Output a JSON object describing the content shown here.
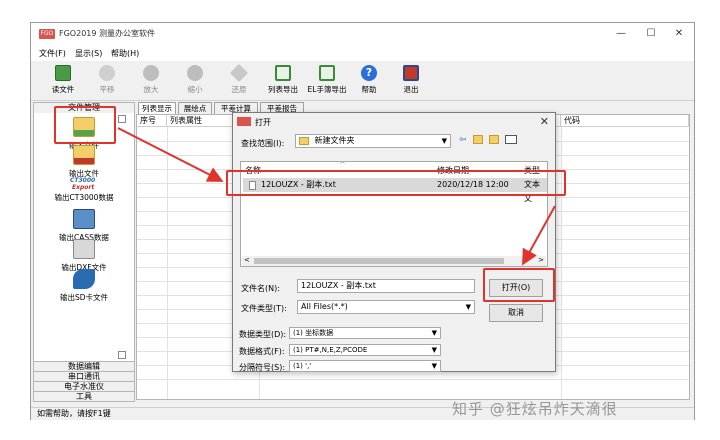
{
  "app": {
    "title": "FGO2019 测量办公室软件",
    "icon_text": "FGO"
  },
  "window_controls": {
    "minimize": "—",
    "maximize": "☐",
    "close": "✕"
  },
  "menu": [
    "文件(F)",
    "显示(S)",
    "帮助(H)"
  ],
  "toolbar": [
    {
      "label": "读文件",
      "icon": "mail-icon",
      "color": "#4a9a4a",
      "enabled": true
    },
    {
      "label": "平移",
      "icon": "hand-icon",
      "color": "#9a9a9a",
      "enabled": false
    },
    {
      "label": "放大",
      "icon": "zoom-in-icon",
      "color": "#9a9a9a",
      "enabled": false
    },
    {
      "label": "缩小",
      "icon": "zoom-out-icon",
      "color": "#9a9a9a",
      "enabled": false
    },
    {
      "label": "还原",
      "icon": "restore-icon",
      "color": "#9a9a9a",
      "enabled": false
    },
    {
      "label": "列表导出",
      "icon": "excel-icon",
      "color": "#3b8a3b",
      "enabled": true
    },
    {
      "label": "EL手簿导出",
      "icon": "excel-icon",
      "color": "#3b8a3b",
      "enabled": true
    },
    {
      "label": "帮助",
      "icon": "help-icon",
      "color": "#2a6ed6",
      "enabled": true
    },
    {
      "label": "退出",
      "icon": "exit-icon",
      "color": "#c0392b",
      "enabled": true
    }
  ],
  "left_panel": {
    "header": "文件管理",
    "items": [
      {
        "label": "输入文件",
        "icon": "input-file-icon",
        "color": "#e8b84a"
      },
      {
        "label": "输出文件",
        "icon": "output-file-icon",
        "color": "#e8b84a"
      },
      {
        "label": "输出CT3000数据",
        "icon": "ct3000-icon",
        "color": "#c03030",
        "brand": "CT3000",
        "brand2": "Export"
      },
      {
        "label": "输出CASS数据",
        "icon": "cass-icon",
        "color": "#4a7ab0"
      },
      {
        "label": "输出DXF文件",
        "icon": "dxf-icon",
        "color": "#8a8a8a"
      },
      {
        "label": "输出SD卡文件",
        "icon": "sd-card-icon",
        "color": "#2a6ab0"
      }
    ],
    "sections": [
      "数据编辑",
      "串口通讯",
      "电子水准仪",
      "工具"
    ]
  },
  "tabs": [
    "列表显示",
    "展绘点",
    "平差计算",
    "平差报告"
  ],
  "grid": {
    "columns": [
      "序号",
      "列表属性",
      "代码"
    ]
  },
  "status_text": "如需帮助，请按F1键",
  "dialog": {
    "title": "打开",
    "look_in_label": "查找范围(I):",
    "look_in_value": "新建文件夹",
    "columns": [
      "名称",
      "修改日期",
      "类型"
    ],
    "files": [
      {
        "name": "12LOUZX - 副本.txt",
        "date": "2020/12/18 12:00",
        "type": "文本文"
      }
    ],
    "filename_label": "文件名(N):",
    "filename_value": "12LOUZX - 副本.txt",
    "filetype_label": "文件类型(T):",
    "filetype_value": "All  Files(*.*)",
    "open_button": "打开(O)",
    "cancel_button": "取消",
    "data_type_label": "数据类型(D):",
    "data_type_value": "(1) 坐标数据",
    "data_format_label": "数据格式(F):",
    "data_format_value": "(1) PT#,N,E,Z,PCODE",
    "separator_label": "分隔符号(S):",
    "separator_value": "(1) ','"
  },
  "watermark": "知乎 @狂炫吊炸天滴很",
  "annotation_color": "#e0332c"
}
